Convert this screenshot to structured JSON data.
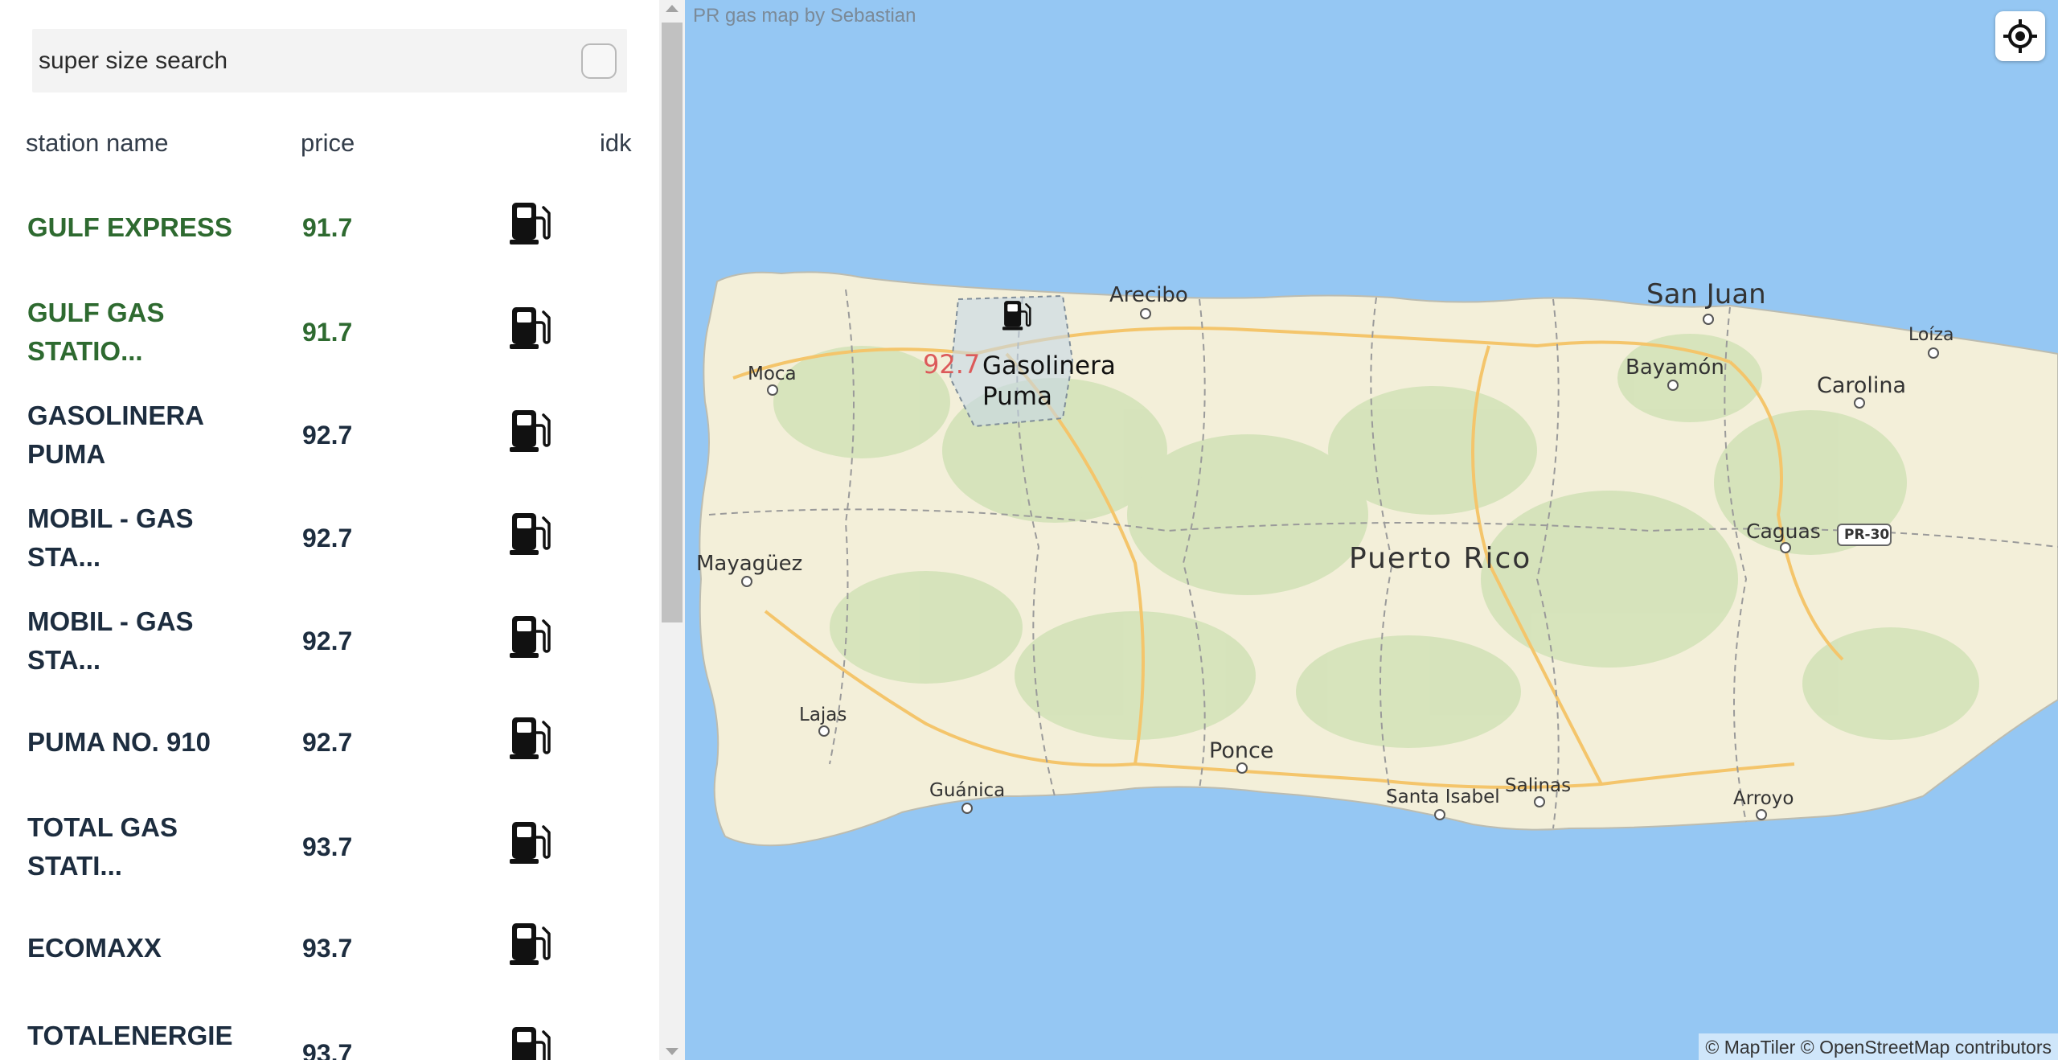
{
  "search": {
    "placeholder": "super size search"
  },
  "table": {
    "headers": {
      "name": "station name",
      "price": "price",
      "action": "idk"
    },
    "rows": [
      {
        "name": "GULF EXPRESS",
        "price": "91.7",
        "icon": "gas-pump-icon",
        "highlight": true
      },
      {
        "name": "GULF GAS STATIO...",
        "price": "91.7",
        "icon": "gas-pump-icon",
        "highlight": true
      },
      {
        "name": "GASOLINERA PUMA",
        "price": "92.7",
        "icon": "gas-pump-icon",
        "highlight": false
      },
      {
        "name": "MOBIL - GAS STA...",
        "price": "92.7",
        "icon": "gas-pump-icon",
        "highlight": false
      },
      {
        "name": "MOBIL - GAS STA...",
        "price": "92.7",
        "icon": "gas-pump-icon",
        "highlight": false
      },
      {
        "name": "PUMA NO. 910",
        "price": "92.7",
        "icon": "gas-pump-icon",
        "highlight": false
      },
      {
        "name": "TOTAL GAS STATI...",
        "price": "93.7",
        "icon": "gas-pump-icon",
        "highlight": false
      },
      {
        "name": "ECOMAXX",
        "price": "93.7",
        "icon": "gas-pump-icon",
        "highlight": false
      },
      {
        "name": "TOTALENERGIE",
        "price": "93.7",
        "icon": "gas-pump-icon",
        "highlight": false
      }
    ]
  },
  "map": {
    "title": "PR gas map by Sebastian",
    "attribution": "© MapTiler © OpenStreetMap contributors",
    "locate_icon": "crosshair-icon",
    "popup": {
      "price": "92.7",
      "name": "Gasolinera Puma"
    },
    "island_label": "Puerto Rico",
    "cities": [
      "Arecibo",
      "San Juan",
      "Loíza",
      "Bayamón",
      "Carolina",
      "Moca",
      "Caguas",
      "Mayagüez",
      "Lajas",
      "Ponce",
      "Guánica",
      "Santa Isabel",
      "Salinas",
      "Arroyo"
    ],
    "road_shield": "PR-30"
  },
  "colors": {
    "cheapest_text": "#2e6a30",
    "default_text": "#1d2d3f",
    "popup_price": "#dc5a5a",
    "water": "#95c7f3",
    "land": "#f3efd9"
  }
}
